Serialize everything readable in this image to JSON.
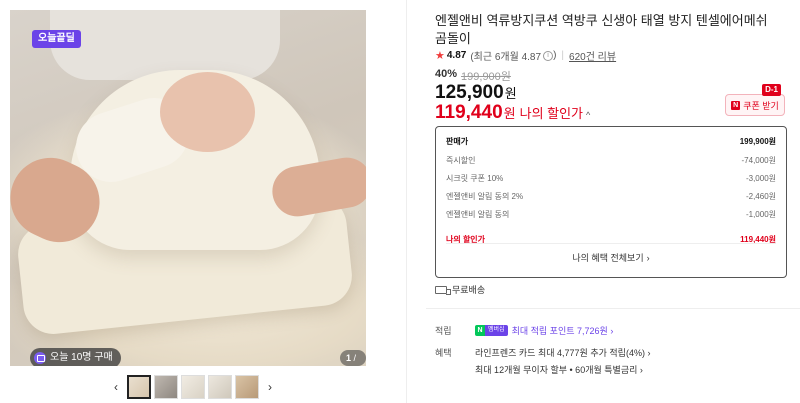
{
  "gallery": {
    "badge": "오늘끝딜",
    "buyers": "오늘 10명 구매",
    "counter_current": "1",
    "counter_total": "/ 11",
    "prev_arrow": "‹",
    "next_arrow": "›",
    "thumbnail_count": 5,
    "active_thumbnail": 1
  },
  "product": {
    "title": "엔젤앤비 역류방지쿠션 역방쿠 신생아 태열 방지 텐셀에어메쉬 곰돌이",
    "rating": "4.87",
    "rating_recent": "(최근 6개월 4.87",
    "rating_close": ")",
    "reviews": "620건 리뷰",
    "discount_rate": "40%",
    "original_price": "199,900원",
    "price": "125,900",
    "price_unit": "원",
    "my_price": "119,440",
    "my_price_unit": "원",
    "my_price_label": "나의 할인가"
  },
  "coupon": {
    "tag": "D-1",
    "label": "쿠폰 받기"
  },
  "breakdown": {
    "rows": [
      {
        "label": "판매가",
        "value": "199,900원"
      },
      {
        "label": "즉시할인",
        "value": "-74,000원"
      },
      {
        "label": "시크릿 쿠폰 10%",
        "value": "-3,000원"
      },
      {
        "label": "엔젤앤비 알림 동의 2%",
        "value": "-2,460원"
      },
      {
        "label": "엔젤앤비 알림 동의",
        "value": "-1,000원"
      }
    ],
    "my_label": "나의 할인가",
    "my_value": "119,440원",
    "more_label": "나의 혜택 전체보기"
  },
  "shipping": {
    "label": "무료배송"
  },
  "benefits": {
    "points_label": "적립",
    "np_n": "N",
    "np_plus": "멤버십",
    "points_text": "최대 적립 포인트 7,726원",
    "card_label": "혜택",
    "card_line1": "라인프렌즈 카드 최대 4,777원 추가 적립(4%)",
    "card_line2": "최대 12개월 무이자 할부 • 60개월 특별금리"
  },
  "colors": {
    "accent_red": "#e0001b",
    "purple": "#6b43e8",
    "naver_green": "#03c75a"
  },
  "icons": [
    "star-icon",
    "info-circle-icon",
    "chevron-up-icon",
    "chevron-right-icon",
    "truck-icon",
    "coupon-logo-icon",
    "chevron-left-icon",
    "shopping-bag-icon"
  ]
}
